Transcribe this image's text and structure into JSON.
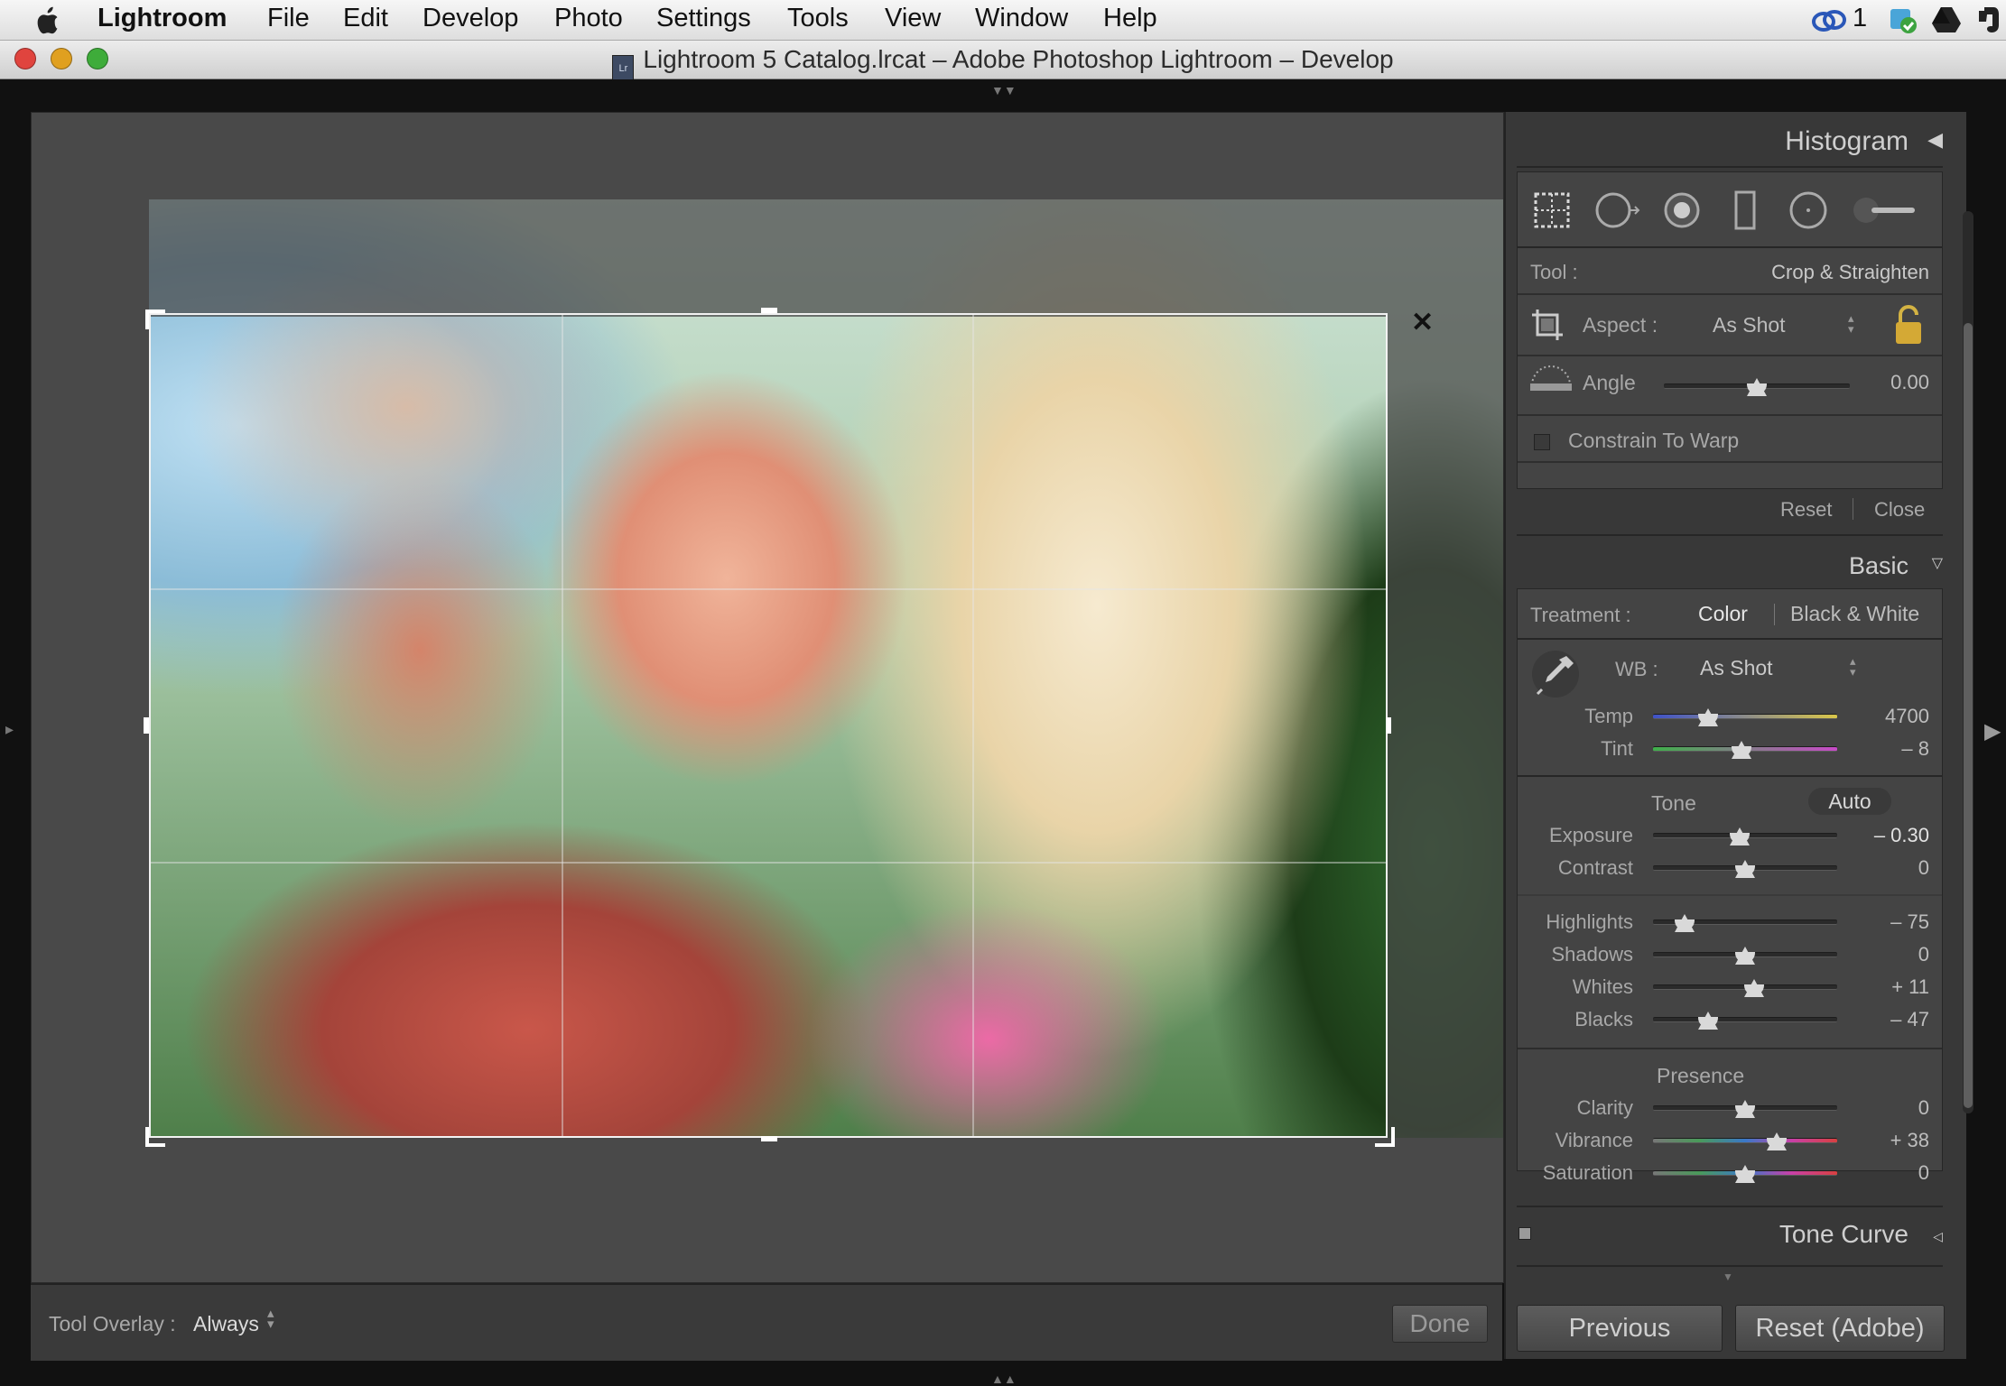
{
  "menubar": {
    "app_name": "Lightroom",
    "items": [
      "File",
      "Edit",
      "Develop",
      "Photo",
      "Settings",
      "Tools",
      "View",
      "Window",
      "Help"
    ],
    "tray_count": "1"
  },
  "window": {
    "title": "Lightroom 5 Catalog.lrcat – Adobe Photoshop Lightroom – Develop",
    "doc_icon": "Lr"
  },
  "toolbar": {
    "overlay_label": "Tool Overlay :",
    "overlay_value": "Always",
    "done_label": "Done"
  },
  "histogram": {
    "title": "Histogram"
  },
  "tool_strip": {
    "icons": [
      "crop-overlay-icon",
      "spot-removal-icon",
      "red-eye-icon",
      "graduated-filter-icon",
      "radial-filter-icon",
      "adjustment-brush-icon"
    ]
  },
  "crop": {
    "tool_label": "Tool :",
    "tool_value": "Crop & Straighten",
    "aspect_label": "Aspect :",
    "aspect_value": "As Shot",
    "angle_label": "Angle",
    "angle_value": "0.00",
    "angle_level": 0.5,
    "constrain_label": "Constrain To Warp",
    "constrain_checked": false,
    "reset_label": "Reset",
    "close_label": "Close"
  },
  "basic": {
    "title": "Basic",
    "treatment_label": "Treatment :",
    "treatment_color": "Color",
    "treatment_bw": "Black & White",
    "wb_label": "WB :",
    "wb_value": "As Shot",
    "tone_label": "Tone",
    "auto_label": "Auto",
    "presence_label": "Presence",
    "sliders": {
      "temp": {
        "label": "Temp",
        "value": "4700",
        "level": 0.3
      },
      "tint": {
        "label": "Tint",
        "value": "– 8",
        "level": 0.48
      },
      "exposure": {
        "label": "Exposure",
        "value": "– 0.30",
        "level": 0.47
      },
      "contrast": {
        "label": "Contrast",
        "value": "0",
        "level": 0.5
      },
      "highlights": {
        "label": "Highlights",
        "value": "– 75",
        "level": 0.17
      },
      "shadows": {
        "label": "Shadows",
        "value": "0",
        "level": 0.5
      },
      "whites": {
        "label": "Whites",
        "value": "+ 11",
        "level": 0.55
      },
      "blacks": {
        "label": "Blacks",
        "value": "– 47",
        "level": 0.3
      },
      "clarity": {
        "label": "Clarity",
        "value": "0",
        "level": 0.5
      },
      "vibrance": {
        "label": "Vibrance",
        "value": "+ 38",
        "level": 0.67
      },
      "saturation": {
        "label": "Saturation",
        "value": "0",
        "level": 0.5
      }
    }
  },
  "tone_curve": {
    "title": "Tone Curve"
  },
  "buttons": {
    "previous": "Previous",
    "reset": "Reset (Adobe)"
  },
  "colors": {
    "panel_bg": "#383838",
    "section_bg": "#444444",
    "canvas_bg": "#494949",
    "temp_gradient": [
      "#3f52c8",
      "#d9c64a"
    ],
    "tint_gradient": [
      "#3fb04a",
      "#c84ac8"
    ]
  }
}
